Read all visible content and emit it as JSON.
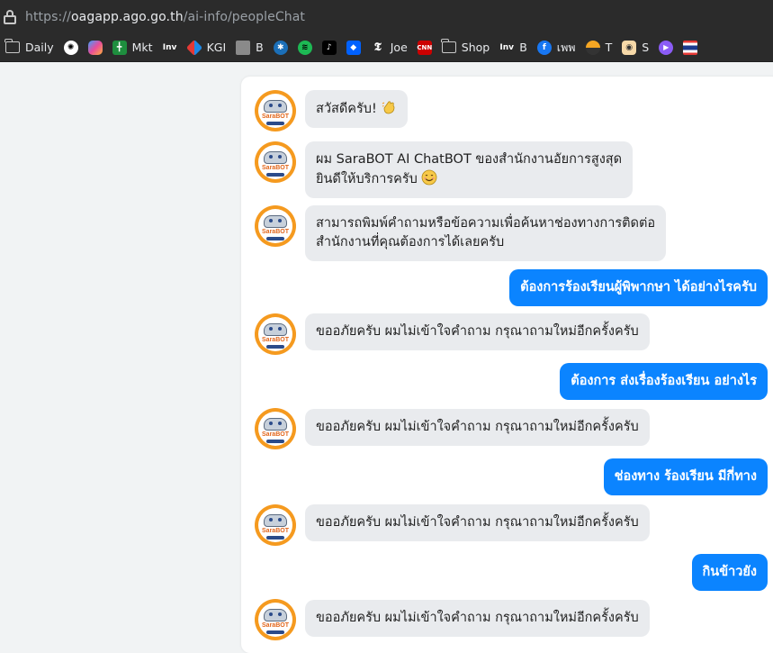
{
  "browser": {
    "url_prefix": "https://",
    "url_host": "oagapp.ago.go.th",
    "url_path": "/ai-info/peopleChat"
  },
  "bookmarks": [
    {
      "label": "Daily",
      "icon": "folder-icon"
    },
    {
      "label": "",
      "icon": "openai-icon"
    },
    {
      "label": "",
      "icon": "copilot-icon"
    },
    {
      "label": "Mkt",
      "icon": "sheets-icon"
    },
    {
      "label": "",
      "icon": "investing-icon"
    },
    {
      "label": "KGI",
      "icon": "kgi-icon"
    },
    {
      "label": "B",
      "icon": "bookmark-b-icon"
    },
    {
      "label": "",
      "icon": "starbucks-icon"
    },
    {
      "label": "",
      "icon": "spotify-icon"
    },
    {
      "label": "",
      "icon": "tiktok-icon"
    },
    {
      "label": "",
      "icon": "dropbox-icon"
    },
    {
      "label": "Joe",
      "icon": "nyt-icon"
    },
    {
      "label": "",
      "icon": "cnn-icon"
    },
    {
      "label": "Shop",
      "icon": "folder-icon"
    },
    {
      "label": "B",
      "icon": "investing-icon"
    },
    {
      "label": "เพพ",
      "icon": "facebook-icon"
    },
    {
      "label": "T",
      "icon": "moon-icon"
    },
    {
      "label": "S",
      "icon": "s-icon"
    },
    {
      "label": "",
      "icon": "play-icon"
    },
    {
      "label": "",
      "icon": "thai-flag-icon"
    }
  ],
  "chat": {
    "bot_avatar_text": "SaraBOT",
    "messages": [
      {
        "from": "bot",
        "lines": [
          "สวัสดีครับ!"
        ],
        "emoji": "clap-emoji-icon"
      },
      {
        "from": "bot",
        "lines": [
          "ผม SaraBOT AI ChatBOT ของสำนักงานอัยการสูงสุด",
          "ยินดีให้บริการครับ"
        ],
        "emoji": "smile-emoji-icon"
      },
      {
        "from": "bot",
        "lines": [
          "สามารถพิมพ์คำถามหรือข้อความเพื่อค้นหาช่องทางการติดต่อ",
          "สำนักงานที่คุณต้องการได้เลยครับ"
        ]
      },
      {
        "from": "user",
        "lines": [
          "ต้องการร้องเรียนผู้พิพากษา ได้อย่างไรครับ"
        ]
      },
      {
        "from": "bot",
        "lines": [
          "ขออภัยครับ ผมไม่เข้าใจคำถาม กรุณาถามใหม่อีกครั้งครับ"
        ]
      },
      {
        "from": "user",
        "lines": [
          "ต้องการ ส่งเรื่องร้องเรียน อย่างไร"
        ]
      },
      {
        "from": "bot",
        "lines": [
          "ขออภัยครับ ผมไม่เข้าใจคำถาม กรุณาถามใหม่อีกครั้งครับ"
        ]
      },
      {
        "from": "user",
        "lines": [
          "ช่องทาง ร้องเรียน มีกี่ทาง"
        ]
      },
      {
        "from": "bot",
        "lines": [
          "ขออภัยครับ ผมไม่เข้าใจคำถาม กรุณาถามใหม่อีกครั้งครับ"
        ]
      },
      {
        "from": "user",
        "lines": [
          "กินข้าวยัง"
        ]
      },
      {
        "from": "bot",
        "lines": [
          "ขออภัยครับ ผมไม่เข้าใจคำถาม กรุณาถามใหม่อีกครั้งครับ"
        ]
      }
    ]
  },
  "colors": {
    "user_bubble": "#0b84ff",
    "bot_bubble": "#e9ebee",
    "avatar_ring": "#f59a1f"
  }
}
